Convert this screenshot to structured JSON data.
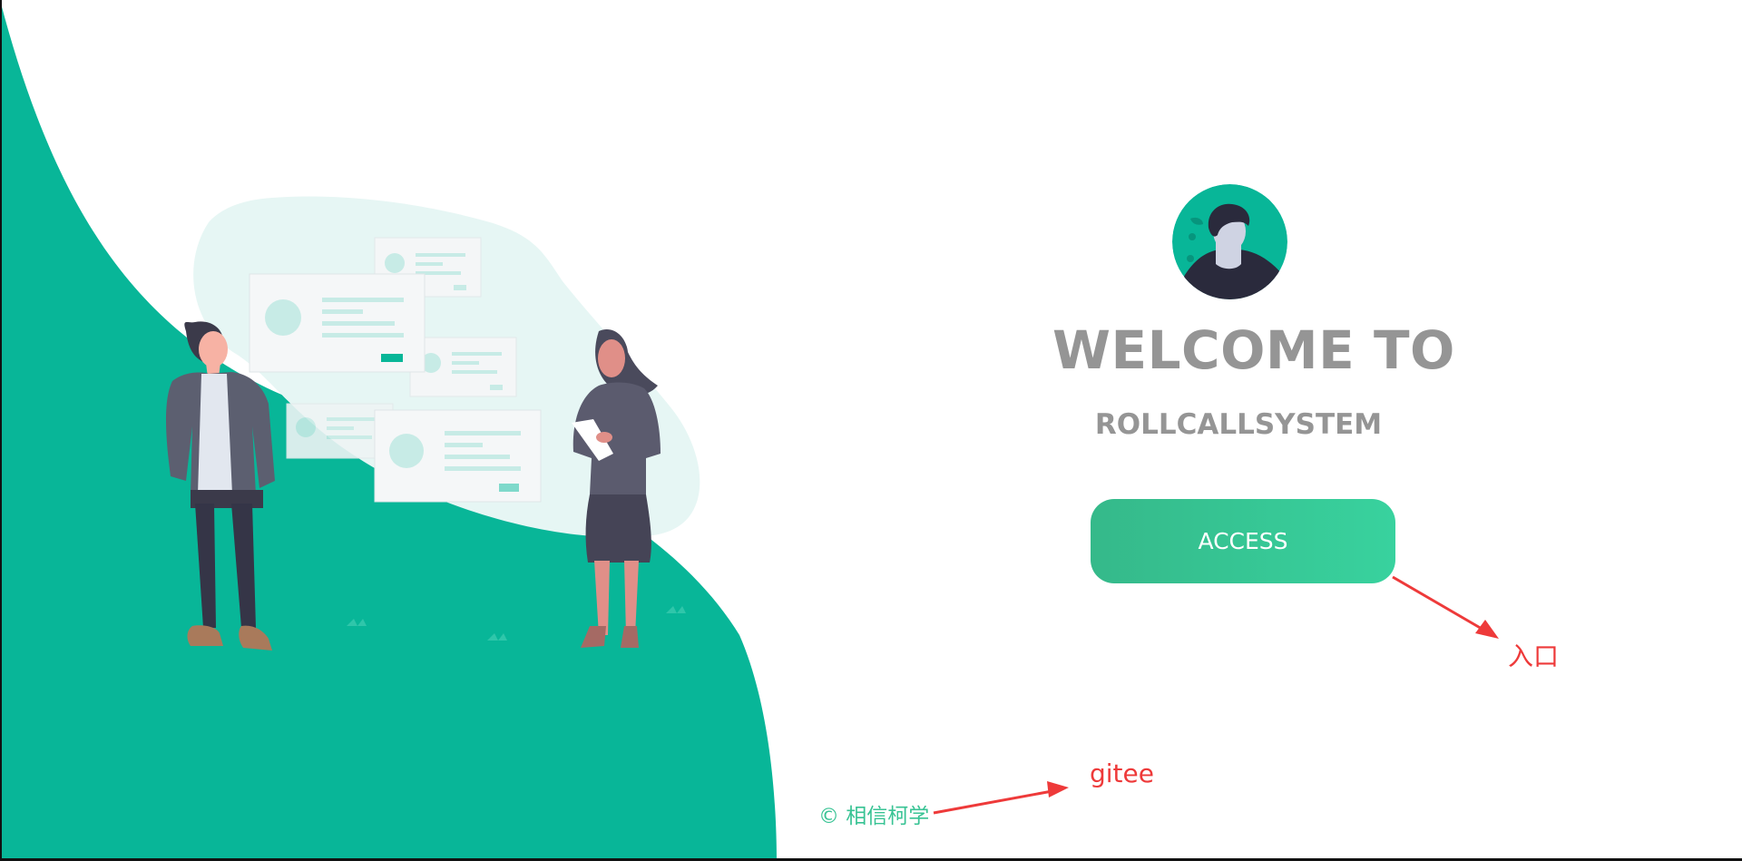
{
  "welcome": {
    "heading": "WELCOME TO",
    "subtitle": "ROLLCALLSYSTEM",
    "button_label": "ACCESS"
  },
  "footer": {
    "copyright": "© 相信柯学"
  },
  "annotations": {
    "entry": "入口",
    "gitee": "gitee"
  },
  "colors": {
    "brand_green": "#08b698",
    "button_start": "#35b98a",
    "button_end": "#38d29e",
    "heading_gray": "#959595",
    "annotation_red": "#ee3a3a"
  }
}
